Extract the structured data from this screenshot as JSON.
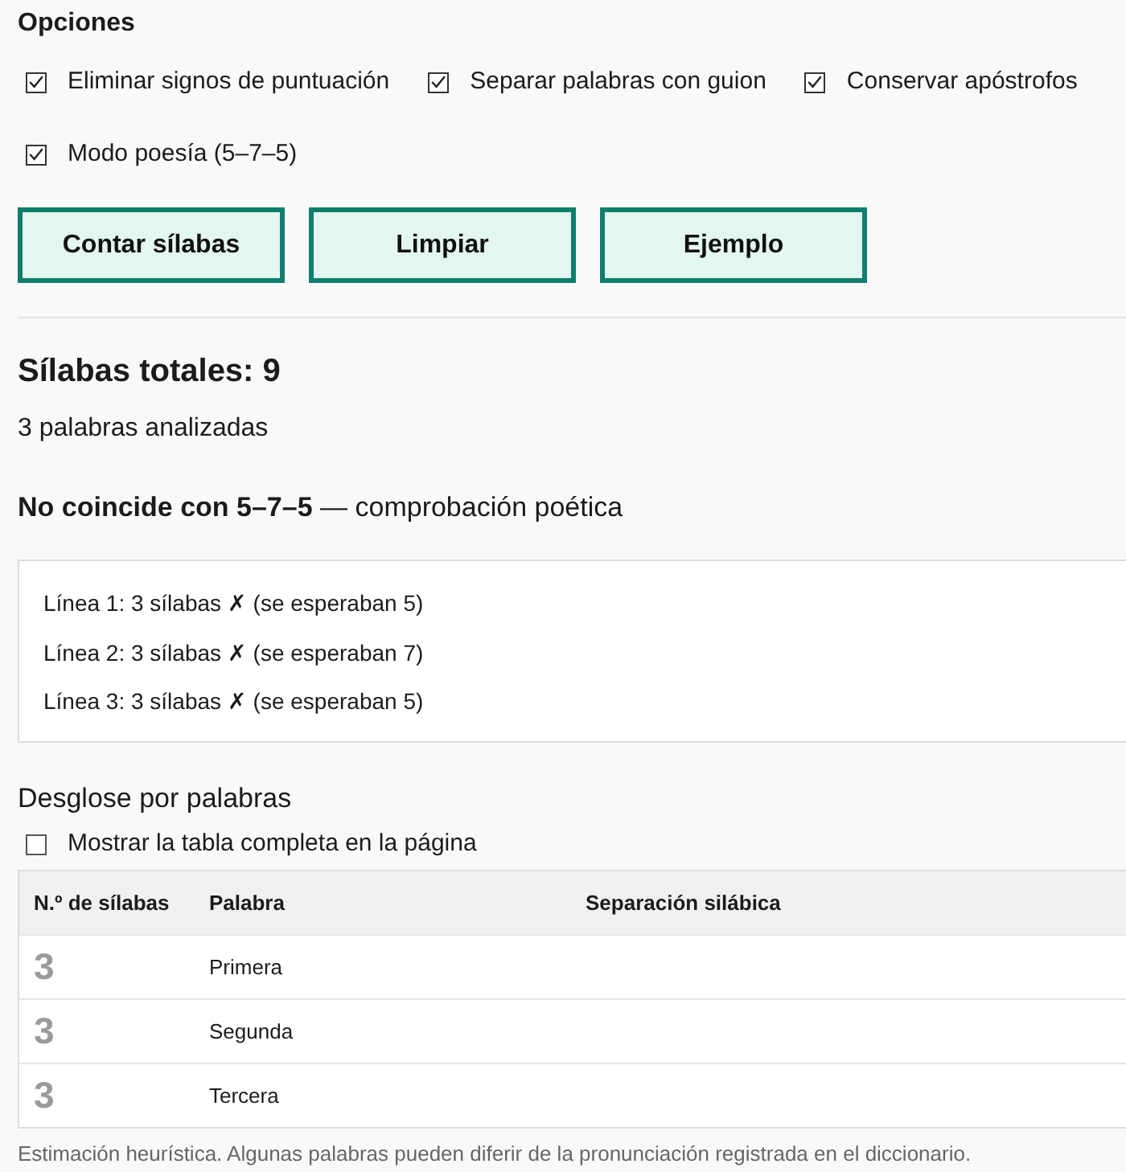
{
  "options": {
    "title": "Opciones",
    "checkboxes": [
      {
        "label": "Eliminar signos de puntuación",
        "checked": true
      },
      {
        "label": "Separar palabras con guion",
        "checked": true
      },
      {
        "label": "Conservar apóstrofos",
        "checked": true
      },
      {
        "label": "Modo poesía (5–7–5)",
        "checked": true
      }
    ]
  },
  "buttons": [
    {
      "label": "Contar sílabas"
    },
    {
      "label": "Limpiar"
    },
    {
      "label": "Ejemplo"
    }
  ],
  "summary": {
    "total": "Sílabas totales: 9",
    "words": "3 palabras analizadas",
    "verdict": "**No coincide con 5–7–5** — comprobación poética"
  },
  "poem_check": {
    "lines": [
      "Línea 1: 3 sílabas ✗ (se esperaban 5)",
      "Línea 2: 3 sílabas ✗ (se esperaban 7)",
      "Línea 3: 3 sílabas ✗ (se esperaban 5)"
    ]
  },
  "breakdown": {
    "title": "Desglose por palabras",
    "show_full_table": {
      "label": "Mostrar la tabla completa en la página",
      "checked": false
    },
    "table": {
      "columns": [
        "N.º de sílabas",
        "Palabra",
        "Separación silábica"
      ],
      "rows": [
        {
          "count": "3",
          "word": "Primera"
        },
        {
          "count": "3",
          "word": "Segunda"
        },
        {
          "count": "3",
          "word": "Tercera"
        }
      ]
    }
  },
  "footnote": "Estimación heurística. Algunas palabras pueden diferir de la pronunciación registrada en el diccionario."
}
